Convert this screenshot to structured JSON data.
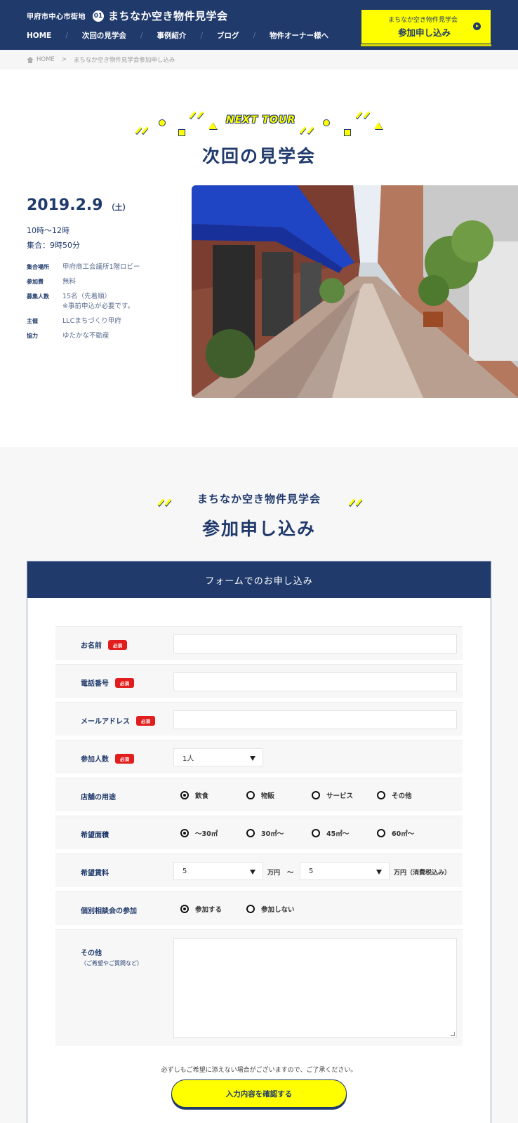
{
  "header": {
    "logo_small": "甲府市中心市街地",
    "logo_mark": "01",
    "logo_main": "まちなか空き物件見学会",
    "nav": [
      "HOME",
      "次回の見学会",
      "事例紹介",
      "ブログ",
      "物件オーナー様へ"
    ],
    "nav_sep": "/",
    "cta_small": "まちなか空き物件見学会",
    "cta_big": "参加申し込み"
  },
  "breadcrumb": {
    "home": "HOME",
    "sep": ">",
    "current": "まちなか空き物件見学会参加申し込み"
  },
  "next_tour": {
    "label": "NEXT TOUR",
    "title": "次回の見学会",
    "date": "2019.2.9",
    "day_of_week": "（土）",
    "time": "10時〜12時",
    "meeting_time": "集合：9時50分",
    "info": [
      {
        "label": "集合場所",
        "value": "甲府商工会議所1階ロビー",
        "note": ""
      },
      {
        "label": "参加費",
        "value": "無料",
        "note": ""
      },
      {
        "label": "募集人数",
        "value": "15名（先着順）",
        "note": "※事前申込が必要です。"
      },
      {
        "label": "主催",
        "value": "LLCまちづくり甲府",
        "note": ""
      },
      {
        "label": "協力",
        "value": "ゆたかな不動産",
        "note": ""
      }
    ]
  },
  "application": {
    "subtitle": "まちなか空き物件見学会",
    "title": "参加申し込み",
    "form_header": "フォームでのお申し込み",
    "required_badge": "必須",
    "fields": {
      "name": "お名前",
      "phone": "電話番号",
      "email": "メールアドレス",
      "participants": "参加人数",
      "participants_value": "1人",
      "usage": "店舗の用途",
      "usage_options": [
        "飲食",
        "物販",
        "サービス",
        "その他"
      ],
      "area": "希望面積",
      "area_options": [
        "〜30㎡",
        "30㎡〜",
        "45㎡〜",
        "60㎡〜"
      ],
      "rent": "希望賃料",
      "rent_from": "5",
      "rent_unit": "万円",
      "rent_tilde": "〜",
      "rent_to": "5",
      "rent_unit_tax": "万円（消費税込み）",
      "consult": "個別相談会の参加",
      "consult_options": [
        "参加する",
        "参加しない"
      ],
      "other": "その他",
      "other_note": "（ご希望やご質問など）"
    },
    "notice": "必ずしもご希望に添えない場合がございますので、ご了承ください。",
    "submit": "入力内容を確認する"
  },
  "colors": {
    "navy": "#203a6c",
    "accent_yellow": "#ffff00",
    "required_red": "#e21d1d"
  }
}
